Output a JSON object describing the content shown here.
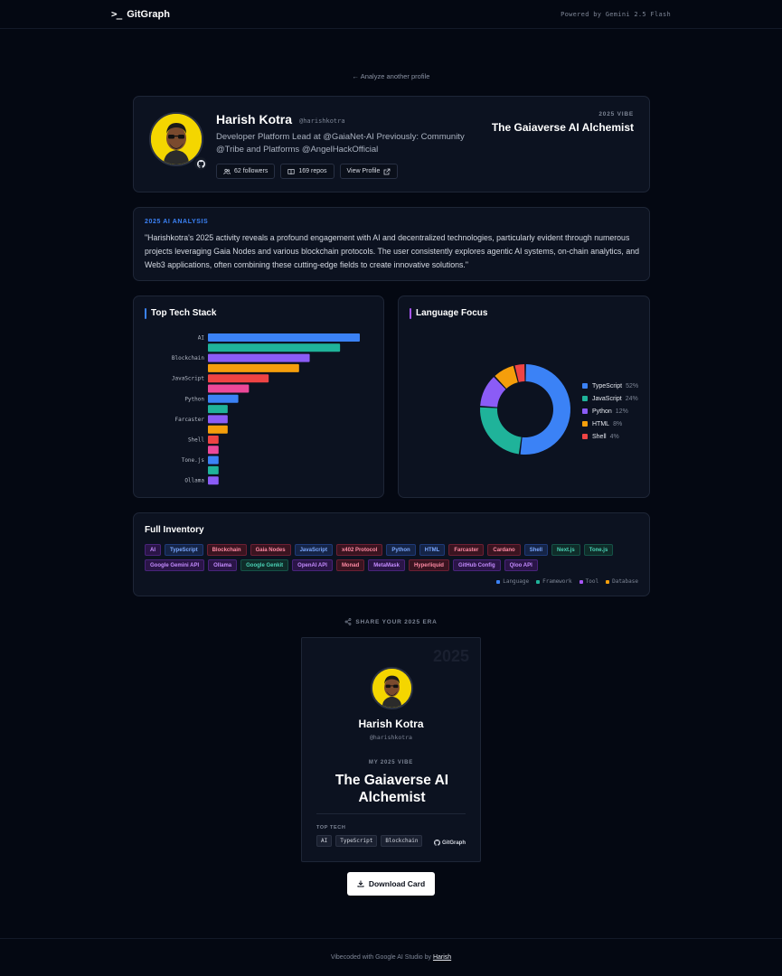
{
  "nav": {
    "brand_icon": ">_",
    "brand": "GitGraph",
    "powered": "Powered by Gemini 2.5 Flash"
  },
  "back_link": "← Analyze another profile",
  "profile": {
    "name": "Harish Kotra",
    "handle": "@harishkotra",
    "bio": "Developer Platform Lead at @GaiaNet-AI Previously: Community @Tribe and Platforms @AngelHackOfficial",
    "followers": "62 followers",
    "repos": "169 repos",
    "view_profile": "View Profile",
    "vibe_label": "2025 VIBE",
    "vibe_title": "The Gaiaverse AI Alchemist"
  },
  "analysis": {
    "label": "2025 AI ANALYSIS",
    "text": "\"Harishkotra's 2025 activity reveals a profound engagement with AI and decentralized technologies, particularly evident through numerous projects leveraging Gaia Nodes and various blockchain protocols. The user consistently explores agentic AI systems, on-chain analytics, and Web3 applications, often combining these cutting-edge fields to create innovative solutions.\""
  },
  "tech_stack": {
    "title": "Top Tech Stack"
  },
  "language_focus": {
    "title": "Language Focus"
  },
  "chart_data": [
    {
      "type": "bar",
      "orientation": "horizontal",
      "title": "Top Tech Stack",
      "categories": [
        "AI",
        "TypeScript",
        "Blockchain",
        "Gaia Nodes",
        "JavaScript",
        "x402 Protocol",
        "Python",
        "HTML",
        "Farcaster",
        "Cardano",
        "Shell",
        "Next.js",
        "Tone.js",
        "Qloo API",
        "Ollama"
      ],
      "tick_labels": [
        "AI",
        "",
        "Blockchain",
        "",
        "JavaScript",
        "",
        "Python",
        "",
        "Farcaster",
        "",
        "Shell",
        "",
        "Tone.js",
        "",
        "Ollama"
      ],
      "values": [
        100,
        87,
        67,
        60,
        40,
        27,
        20,
        13,
        13,
        13,
        7,
        7,
        7,
        7,
        7
      ],
      "colors": [
        "#3b82f6",
        "#1fb39a",
        "#8b5cf6",
        "#f59e0b",
        "#ef4444",
        "#ec4899",
        "#3b82f6",
        "#1fb39a",
        "#8b5cf6",
        "#f59e0b",
        "#ef4444",
        "#ec4899",
        "#3b82f6",
        "#1fb39a",
        "#8b5cf6"
      ],
      "xlim": [
        0,
        100
      ],
      "grid": false,
      "legend": "none"
    },
    {
      "type": "pie",
      "variant": "donut",
      "title": "Language Focus",
      "labels": [
        "TypeScript",
        "JavaScript",
        "Python",
        "HTML",
        "Shell"
      ],
      "values": [
        52,
        24,
        12,
        8,
        4
      ],
      "value_suffix": "%",
      "colors": [
        "#3b82f6",
        "#1fb39a",
        "#8b5cf6",
        "#f59e0b",
        "#ef4444"
      ],
      "legend": "right"
    }
  ],
  "inventory": {
    "title": "Full Inventory",
    "items": [
      {
        "label": "AI",
        "category": "Tool"
      },
      {
        "label": "TypeScript",
        "category": "Language"
      },
      {
        "label": "Blockchain",
        "category": "Database"
      },
      {
        "label": "Gaia Nodes",
        "category": "Database"
      },
      {
        "label": "JavaScript",
        "category": "Language"
      },
      {
        "label": "x402 Protocol",
        "category": "Database"
      },
      {
        "label": "Python",
        "category": "Language"
      },
      {
        "label": "HTML",
        "category": "Language"
      },
      {
        "label": "Farcaster",
        "category": "Database"
      },
      {
        "label": "Cardano",
        "category": "Database"
      },
      {
        "label": "Shell",
        "category": "Language"
      },
      {
        "label": "Next.js",
        "category": "Framework"
      },
      {
        "label": "Tone.js",
        "category": "Framework"
      },
      {
        "label": "Google Gemini API",
        "category": "Tool"
      },
      {
        "label": "Ollama",
        "category": "Tool"
      },
      {
        "label": "Google Genkit",
        "category": "Framework"
      },
      {
        "label": "OpenAI API",
        "category": "Tool"
      },
      {
        "label": "Monad",
        "category": "Database"
      },
      {
        "label": "MetaMask",
        "category": "Tool"
      },
      {
        "label": "Hyperliquid",
        "category": "Database"
      },
      {
        "label": "GitHub Config",
        "category": "Tool"
      },
      {
        "label": "Qloo API",
        "category": "Tool"
      }
    ],
    "legend": [
      {
        "label": "Language",
        "color": "#3b82f6"
      },
      {
        "label": "Framework",
        "color": "#1fb39a"
      },
      {
        "label": "Tool",
        "color": "#a855f7"
      },
      {
        "label": "Database",
        "color": "#f59e0b"
      }
    ]
  },
  "share": {
    "heading": "SHARE YOUR 2025 ERA",
    "year": "2025",
    "name": "Harish Kotra",
    "handle": "@harishkotra",
    "vibe_label": "MY 2025 VIBE",
    "vibe": "The Gaiaverse AI Alchemist",
    "top_tech_label": "TOP TECH",
    "top_tech": [
      "AI",
      "TypeScript",
      "Blockchain"
    ],
    "brand": "GitGraph"
  },
  "download": "Download Card",
  "footer": {
    "text": "Vibecoded with Google AI Studio by",
    "link": "Harish"
  }
}
